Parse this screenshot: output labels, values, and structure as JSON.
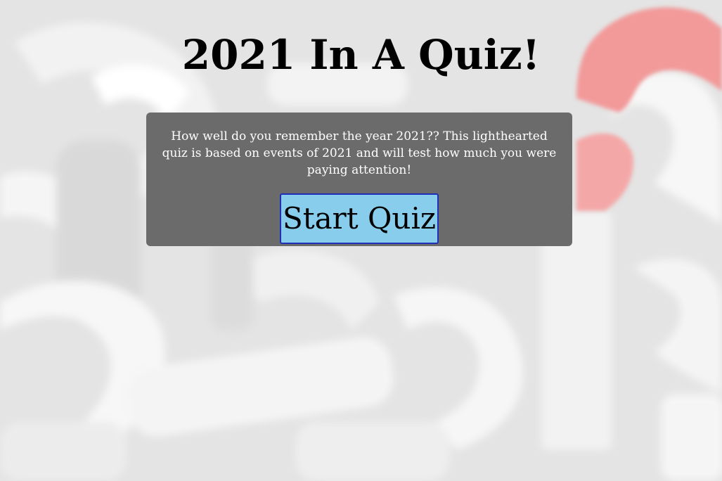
{
  "page": {
    "title": "2021 In A Quiz!"
  },
  "intro": {
    "text": "How well do you remember the year 2021?? This lighthearted quiz is based on events of 2021 and will test how much you were paying attention!",
    "start_label": "Start Quiz"
  },
  "colors": {
    "background": "#e9e9e9",
    "card": "#6b6b6b",
    "button": "#89cdec",
    "button_border": "#1f2fb8",
    "accent_red": "#f0a3a3"
  },
  "background_image": {
    "icon": "question-marks-pattern"
  }
}
